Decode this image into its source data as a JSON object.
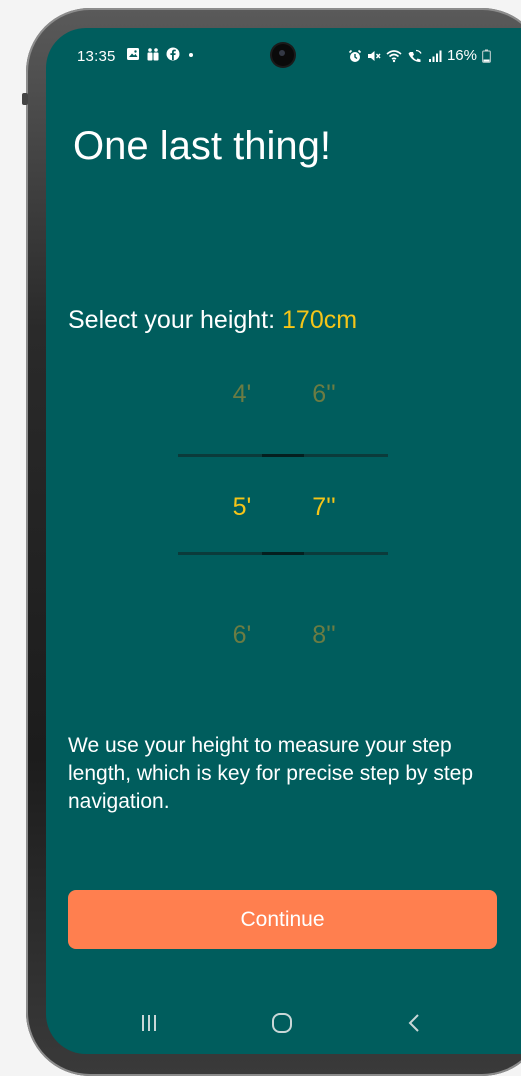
{
  "status_bar": {
    "time": "13:35",
    "battery": "16%",
    "left_icons": [
      "gallery-icon",
      "teams-icon",
      "facebook-icon",
      "dot-icon"
    ],
    "right_icons": [
      "alarm-icon",
      "mute-icon",
      "wifi-icon",
      "wifi-call-icon",
      "signal-icon",
      "battery-icon"
    ]
  },
  "screen": {
    "title": "One last thing!",
    "height_label": "Select your height:",
    "height_value": "170cm",
    "description": "We use your height to measure your step length, which is key for precise step by step navigation.",
    "continue_label": "Continue"
  },
  "picker": {
    "feet": {
      "above": "4'",
      "selected": "5'",
      "below": "6'"
    },
    "inches": {
      "above": "6''",
      "selected": "7''",
      "below": "8''"
    }
  },
  "nav_bar": {
    "recent_icon": "recent-apps-icon",
    "home_icon": "home-icon",
    "back_icon": "back-icon"
  },
  "colors": {
    "background": "#005d5d",
    "accent": "#f5c518",
    "dim": "#6b7c43",
    "button": "#ff7f4f",
    "text": "#ffffff"
  }
}
